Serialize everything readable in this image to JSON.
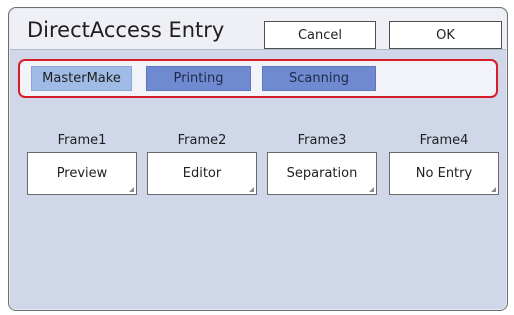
{
  "dialog": {
    "title": "DirectAccess Entry",
    "cancel_label": "Cancel",
    "ok_label": "OK"
  },
  "tabs": [
    {
      "label": "MasterMake",
      "active": true
    },
    {
      "label": "Printing",
      "active": false
    },
    {
      "label": "Scanning",
      "active": false
    }
  ],
  "frames": [
    {
      "label": "Frame1",
      "value": "Preview"
    },
    {
      "label": "Frame2",
      "value": "Editor"
    },
    {
      "label": "Frame3",
      "value": "Separation"
    },
    {
      "label": "Frame4",
      "value": "No Entry"
    }
  ],
  "colors": {
    "panel_bg": "#cfd7e8",
    "tab_active": "#9fbbe6",
    "tab_inactive": "#6f8ad0",
    "highlight_border": "#d61e2a"
  }
}
